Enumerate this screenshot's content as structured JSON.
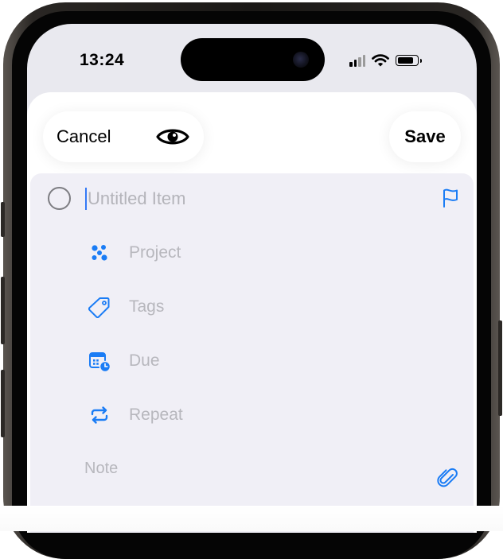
{
  "status_bar": {
    "time": "13:24",
    "icons": [
      "cellular-signal-icon",
      "wifi-icon",
      "battery-icon"
    ]
  },
  "toolbar": {
    "cancel_label": "Cancel",
    "preview_icon": "eye-icon",
    "save_label": "Save"
  },
  "item": {
    "title_placeholder": "Untitled Item",
    "fields": [
      {
        "icon": "project-icon",
        "label": "Project"
      },
      {
        "icon": "tag-icon",
        "label": "Tags"
      },
      {
        "icon": "calendar-clock-icon",
        "label": "Due"
      },
      {
        "icon": "repeat-icon",
        "label": "Repeat"
      }
    ],
    "note_placeholder": "Note"
  },
  "colors": {
    "accent": "#1a7cf5",
    "placeholder": "#b7b7bd",
    "card_background": "#f0eff6"
  }
}
